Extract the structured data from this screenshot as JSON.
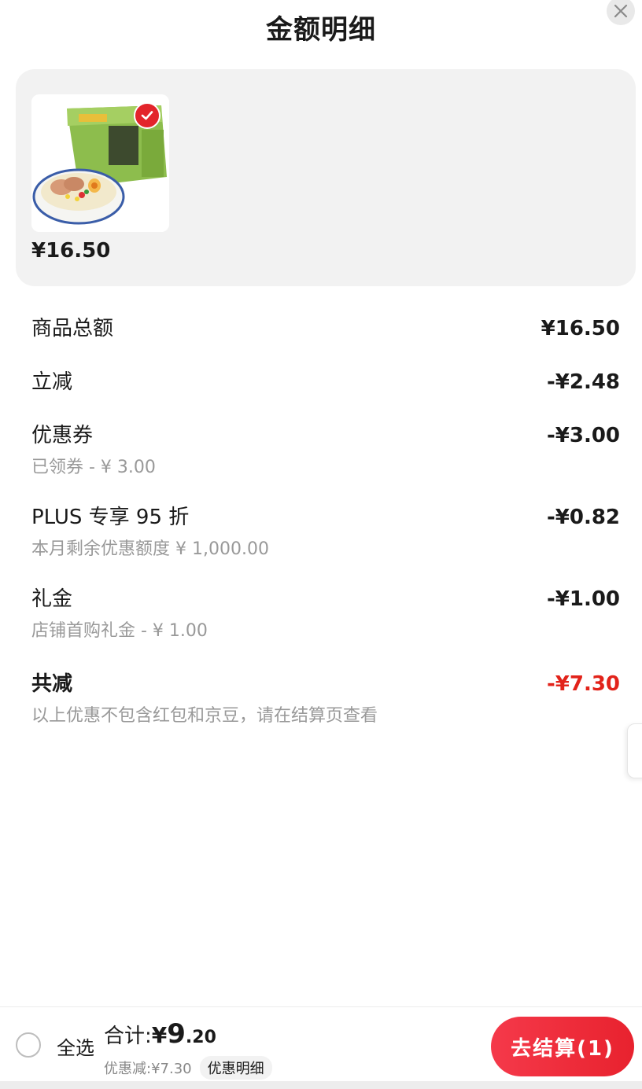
{
  "header": {
    "title": "金额明细"
  },
  "product": {
    "price": "¥16.50"
  },
  "rows": [
    {
      "label": "商品总额",
      "amount": "¥16.50",
      "sub": ""
    },
    {
      "label": "立减",
      "amount": "-¥2.48",
      "sub": ""
    },
    {
      "label": "优惠券",
      "amount": "-¥3.00",
      "sub": "已领券 - ¥ 3.00"
    },
    {
      "label": "PLUS 专享 95 折",
      "amount": "-¥0.82",
      "sub": "本月剩余优惠额度 ¥ 1,000.00"
    },
    {
      "label": "礼金",
      "amount": "-¥1.00",
      "sub": "店铺首购礼金 - ¥ 1.00"
    },
    {
      "label": "共减",
      "amount": "-¥7.30",
      "sub": "以上优惠不包含红包和京豆，请在结算页查看"
    }
  ],
  "footer": {
    "select_all": "全选",
    "total_label": "合计:",
    "total_currency": "¥",
    "total_int": "9",
    "total_dec": ".20",
    "discount_text": "优惠减:¥7.30",
    "detail_chip": "优惠明细",
    "checkout_label": "去结算(1)"
  },
  "colors": {
    "accent_red": "#e2231a",
    "button_red": "#f5394a"
  }
}
